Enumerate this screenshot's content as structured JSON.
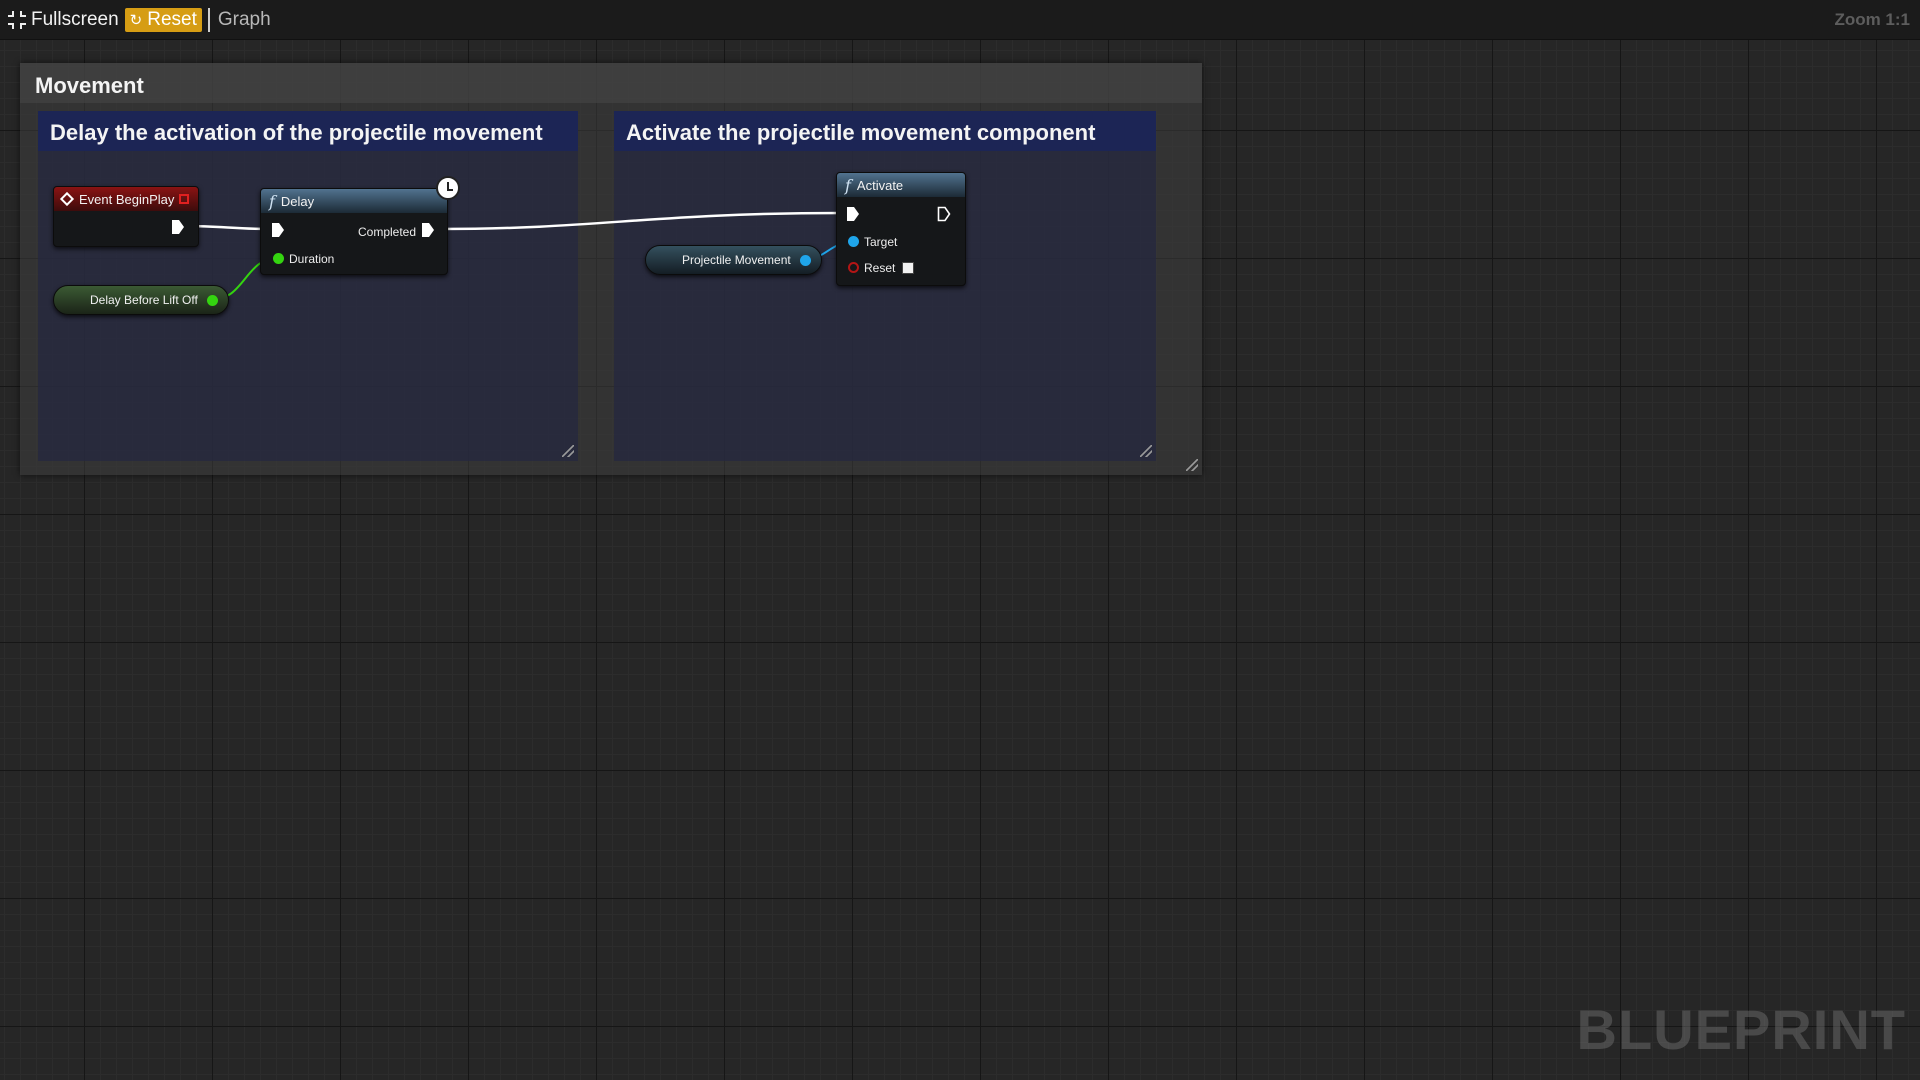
{
  "toolbar": {
    "fullscreen_label": "Fullscreen",
    "reset_label": "Reset",
    "graph_label": "Graph",
    "zoom_label": "Zoom 1:1"
  },
  "comments": {
    "outer_title": "Movement",
    "left_title": "Delay the activation of the projectile movement",
    "right_title": "Activate the projectile movement component"
  },
  "nodes": {
    "begin_play": {
      "title": "Event BeginPlay"
    },
    "delay": {
      "title": "Delay",
      "completed_label": "Completed",
      "duration_label": "Duration"
    },
    "activate": {
      "title": "Activate",
      "target_label": "Target",
      "reset_label": "Reset"
    },
    "delay_var": {
      "label": "Delay Before Lift Off"
    },
    "projectile_var": {
      "label": "Projectile Movement"
    }
  },
  "colors": {
    "event_header": "#8a1313",
    "function_header": "#51728f",
    "float_pin": "#34d410",
    "object_pin": "#1fa5ea",
    "bool_pin": "#b31515",
    "exec_wire": "#ffffff",
    "reset_button": "#d69d14"
  },
  "watermark": "BLUEPRINT"
}
